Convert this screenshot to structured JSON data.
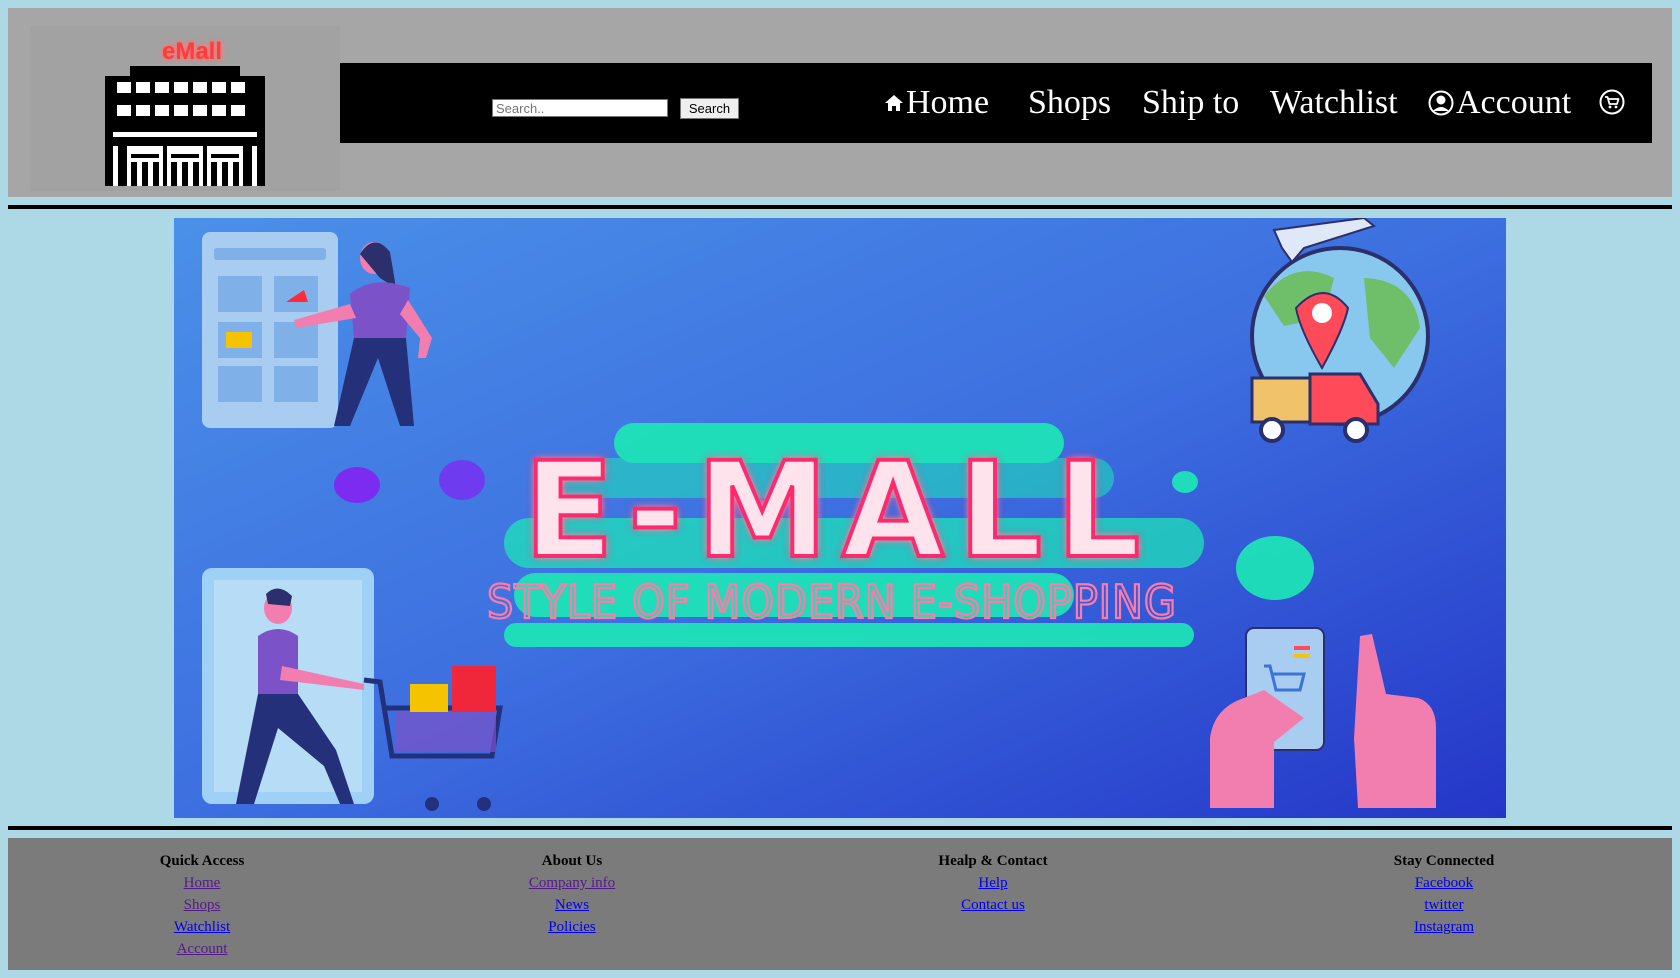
{
  "header": {
    "logo_text": "eMall",
    "search": {
      "placeholder": "Search..",
      "value": "",
      "button_label": "Search"
    },
    "nav": {
      "home": "Home",
      "shops": "Shops",
      "ship_to": "Ship to",
      "watchlist": "Watchlist",
      "account": "Account"
    }
  },
  "banner": {
    "title": "E-MALL",
    "subtitle": "STYLE OF MODERN E-SHOPPING"
  },
  "footer": {
    "quick_access": {
      "heading": "Quick Access",
      "links": [
        "Home",
        "Shops",
        "Watchlist",
        "Account"
      ]
    },
    "about_us": {
      "heading": "About Us",
      "links": [
        "Company info",
        "News",
        "Policies"
      ]
    },
    "help_contact": {
      "heading": "Healp & Contact",
      "links": [
        "Help",
        "Contact us"
      ]
    },
    "stay_connected": {
      "heading": "Stay Connected",
      "links": [
        "Facebook",
        "twitter",
        "Instagram"
      ]
    }
  },
  "colors": {
    "page_bg": "#add8e6",
    "header_bg": "#a6a6a6",
    "navbar_bg": "#000000",
    "footer_bg": "#7b7b7b",
    "logo_text": "#ff3b3b",
    "banner_title_glow": "#ff3a7a",
    "banner_splash": "#1de9b6"
  },
  "icons": [
    "home-icon",
    "account-icon",
    "cart-icon",
    "logo-building-icon"
  ]
}
